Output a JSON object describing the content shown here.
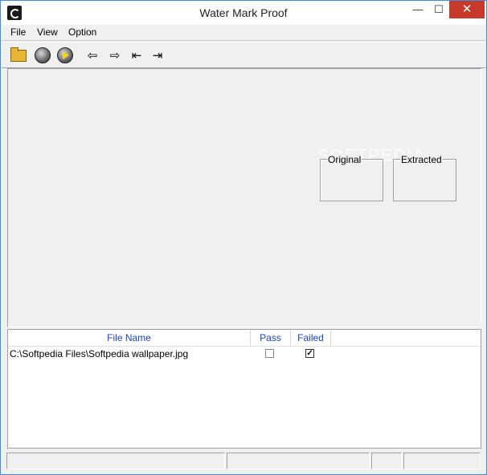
{
  "window": {
    "title": "Water Mark Proof",
    "controls": {
      "minimize": "—",
      "maximize": "☐",
      "close": "✕"
    }
  },
  "menu": {
    "file": "File",
    "view": "View",
    "option": "Option"
  },
  "toolbar": {
    "icons": [
      "open-folder-icon",
      "embed-disc-icon",
      "play-disc-icon",
      "arrow-left-icon",
      "arrow-right-icon",
      "arrow-first-icon",
      "arrow-last-icon"
    ],
    "prev": "⇦",
    "next": "⇨",
    "first": "⇤",
    "last": "⇥"
  },
  "preview": {
    "original_label": "Original",
    "extracted_label": "Extracted",
    "watermark": "SOFTPEDIA"
  },
  "list": {
    "columns": [
      "File Name",
      "Pass",
      "Failed"
    ],
    "rows": [
      {
        "file_name": "C:\\Softpedia Files\\Softpedia wallpaper.jpg",
        "pass": false,
        "failed": true
      }
    ]
  },
  "colors": {
    "header_text": "#1a3fd6",
    "close_button": "#c7392b",
    "window_border": "#3c8ddb"
  }
}
